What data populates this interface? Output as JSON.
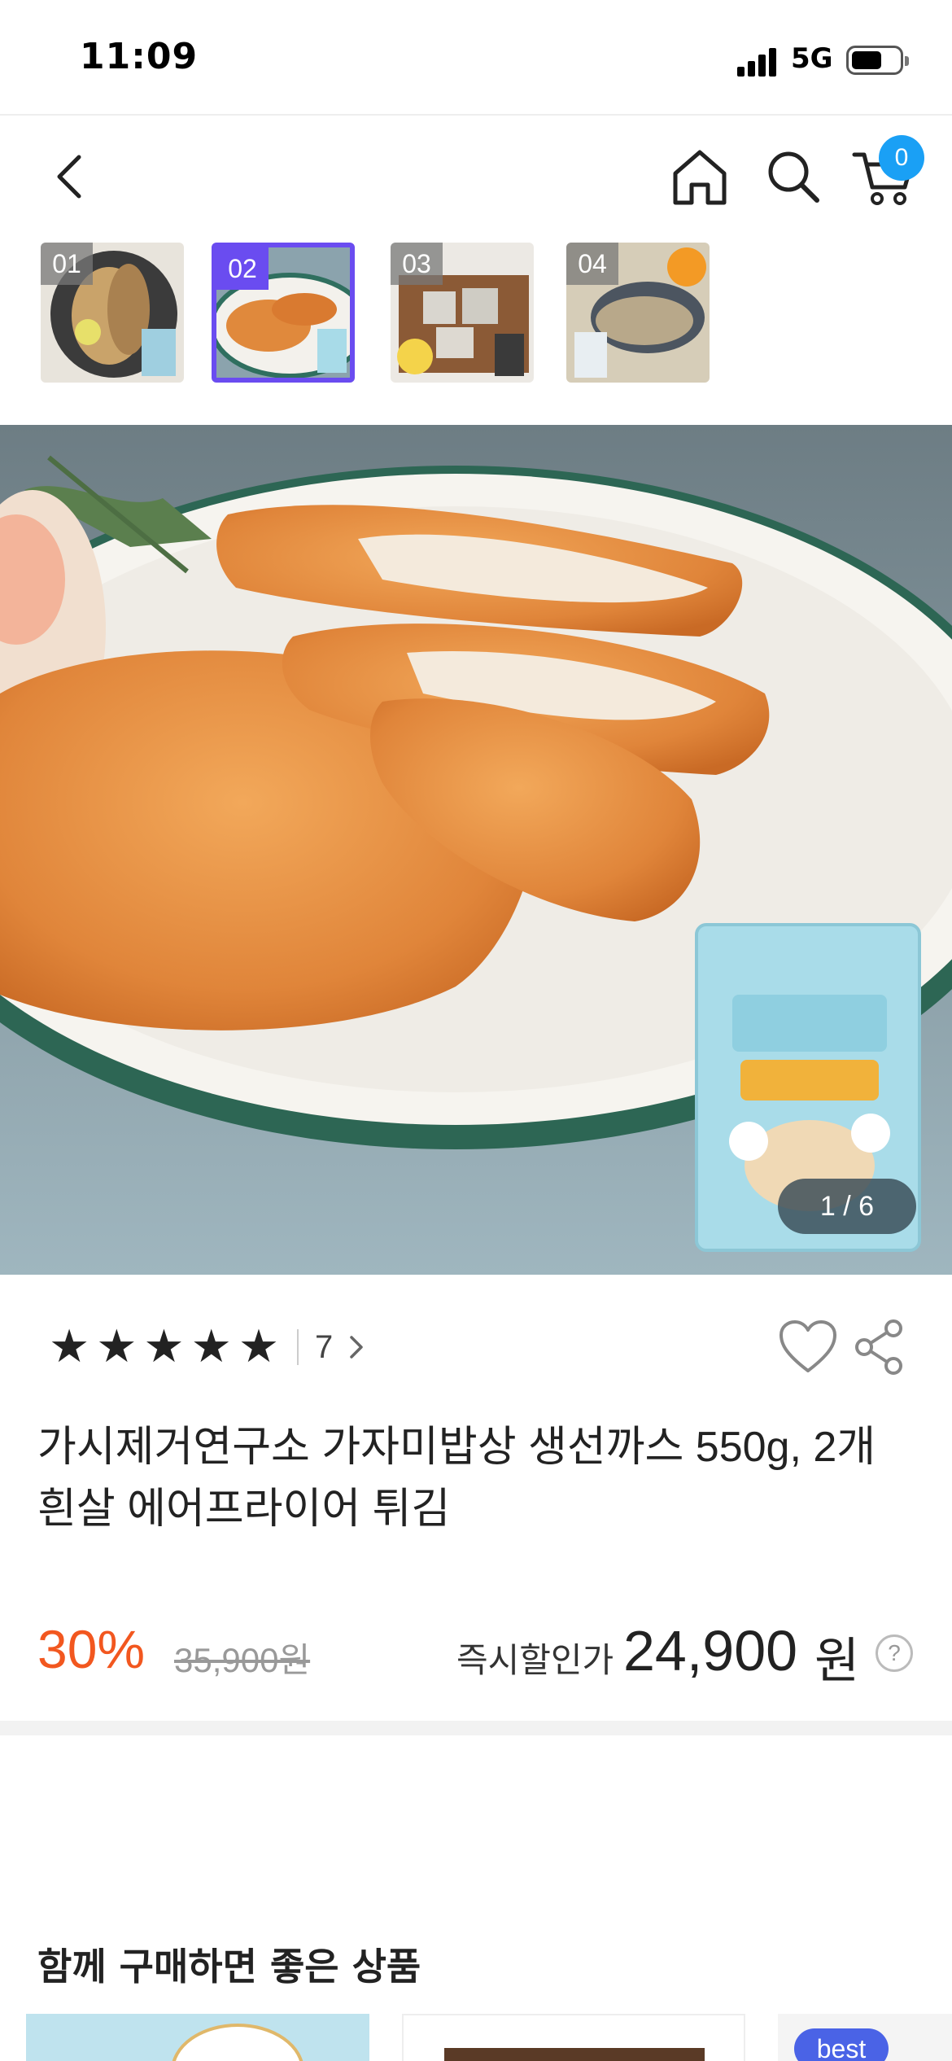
{
  "status_bar": {
    "time": "11:09",
    "network": "5G"
  },
  "nav": {
    "cart_count": "0"
  },
  "thumbnails": [
    {
      "label": "01"
    },
    {
      "label": "02",
      "active": true
    },
    {
      "label": "03"
    },
    {
      "label": "04"
    }
  ],
  "hero": {
    "counter": "1 / 6"
  },
  "product": {
    "rating_stars": 5,
    "review_count": "7",
    "title": "가시제거연구소 가자미밥상 생선까스 550g, 2개 흰살 에어프라이어 튀김",
    "discount": "30%",
    "original_price": "35,900원",
    "instant_label": "즉시할인가",
    "sale_price": "24,900",
    "currency": "원",
    "help": "?"
  },
  "recommend": {
    "title": "함께 구매하면 좋은 상품",
    "best_badge": "best"
  },
  "colors": {
    "accent": "#6a4cf0",
    "discount": "#f2571f",
    "badge": "#1aa0f5"
  }
}
